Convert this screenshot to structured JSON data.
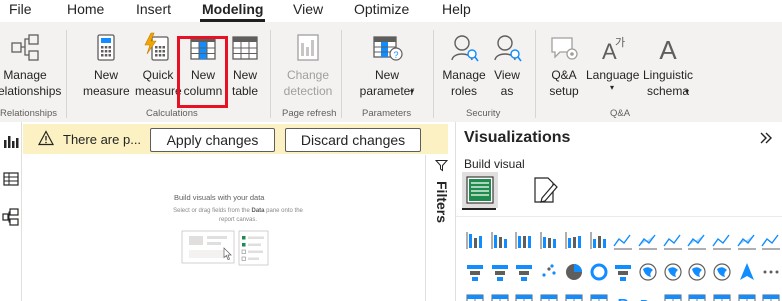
{
  "menu": {
    "tabs": [
      "File",
      "Home",
      "Insert",
      "Modeling",
      "View",
      "Optimize",
      "Help"
    ],
    "active": "Modeling"
  },
  "ribbon": {
    "manage_relationships": "Manage\nrelationships",
    "new_measure": "New\nmeasure",
    "quick_measure": "Quick\nmeasure",
    "new_column": "New\ncolumn",
    "new_table": "New\ntable",
    "change_detection": "Change\ndetection",
    "new_parameter": "New\nparameter",
    "manage_roles": "Manage\nroles",
    "view_as": "View\nas",
    "qa_setup": "Q&A\nsetup",
    "language": "Language",
    "linguistic_schema": "Linguistic\nschema",
    "groups": {
      "relationships": "Relationships",
      "calculations": "Calculations",
      "page_refresh": "Page refresh",
      "parameters": "Parameters",
      "security": "Security",
      "qa": "Q&A"
    }
  },
  "notice": {
    "text": "There are p...",
    "apply": "Apply changes",
    "discard": "Discard changes"
  },
  "canvas": {
    "empty_title": "Build visuals with your data",
    "empty_sub_1": "Select or drag fields from the ",
    "empty_sub_bold": "Data",
    "empty_sub_2": " pane onto the report canvas."
  },
  "filters": {
    "label": "Filters"
  },
  "visualizations": {
    "title": "Visualizations",
    "build_visual": "Build visual"
  },
  "colors": {
    "accent": "#118dff",
    "highlight": "#e81123",
    "notice_bg": "#fcf1c3",
    "ribbon_bg": "#f3f2f1"
  }
}
